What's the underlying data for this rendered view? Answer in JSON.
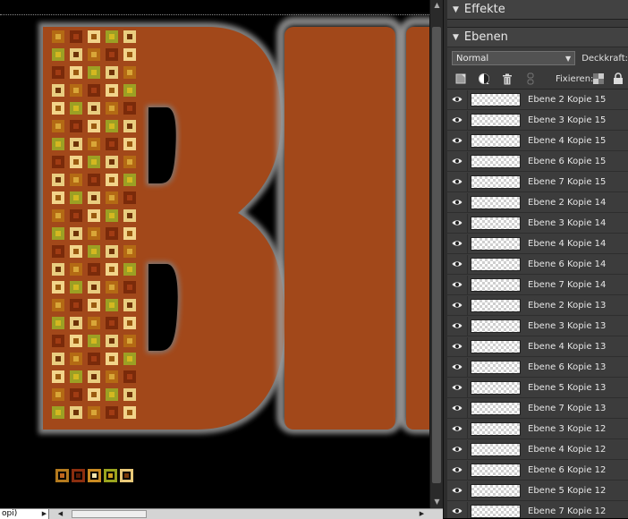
{
  "window": {
    "status_field": "opi)"
  },
  "panels": {
    "effects": {
      "title": "Effekte"
    },
    "layers_panel": {
      "title": "Ebenen",
      "blend_mode": "Normal",
      "opacity_label": "Deckkraft:",
      "lock_label": "Fixieren:",
      "layers": [
        "Ebene 2 Kopie 15",
        "Ebene 3 Kopie 15",
        "Ebene 4 Kopie 15",
        "Ebene 6 Kopie 15",
        "Ebene 7 Kopie 15",
        "Ebene 2 Kopie 14",
        "Ebene 3 Kopie 14",
        "Ebene 4 Kopie 14",
        "Ebene 6 Kopie 14",
        "Ebene 7 Kopie 14",
        "Ebene 2 Kopie 13",
        "Ebene 3 Kopie 13",
        "Ebene 4 Kopie 13",
        "Ebene 6 Kopie 13",
        "Ebene 5 Kopie 13",
        "Ebene 7 Kopie 13",
        "Ebene 3 Kopie 12",
        "Ebene 4 Kopie 12",
        "Ebene 6 Kopie 12",
        "Ebene 5 Kopie 12",
        "Ebene 7 Kopie 12"
      ]
    }
  },
  "colors": {
    "letter_fill": "#a2481a",
    "letter_outline": "#8a8a8a",
    "panel_bg": "#3a3a3a"
  },
  "icons": {
    "eye": "eye-icon",
    "new_layer": "new-layer-icon",
    "adjustment": "adjustment-layer-icon",
    "delete": "trash-icon",
    "link": "link-icon",
    "lock_transparent": "lock-transparent-icon",
    "lock_all": "lock-icon"
  }
}
